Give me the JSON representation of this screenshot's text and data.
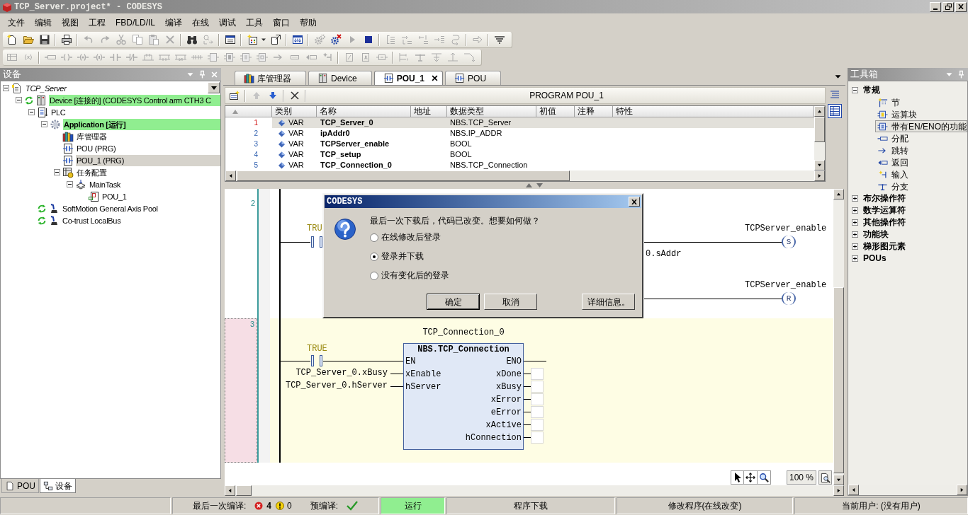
{
  "window": {
    "title": "TCP_Server.project* - CODESYS"
  },
  "menu": [
    "文件",
    "编辑",
    "视图",
    "工程",
    "FBD/LD/IL",
    "编译",
    "在线",
    "调试",
    "工具",
    "窗口",
    "帮助"
  ],
  "toolbar_1": [
    [
      {
        "kind": "new",
        "disabled": false
      },
      {
        "kind": "open",
        "disabled": false
      },
      {
        "kind": "save",
        "disabled": false
      }
    ],
    [
      {
        "kind": "print",
        "disabled": false
      }
    ],
    [
      {
        "kind": "undo",
        "disabled": true
      },
      {
        "kind": "redo",
        "disabled": true
      },
      {
        "kind": "cut",
        "disabled": true
      },
      {
        "kind": "copy",
        "disabled": true
      },
      {
        "kind": "paste",
        "disabled": true
      },
      {
        "kind": "delete",
        "disabled": true
      }
    ],
    [
      {
        "kind": "find",
        "disabled": false
      },
      {
        "kind": "replace",
        "disabled": true
      }
    ],
    [
      {
        "kind": "windows",
        "disabled": false
      }
    ],
    [
      {
        "kind": "additem",
        "disabled": false
      },
      {
        "kind": "caret",
        "disabled": false
      },
      {
        "kind": "export",
        "disabled": false
      }
    ],
    [
      {
        "kind": "build",
        "disabled": false
      }
    ],
    [
      {
        "kind": "gear",
        "disabled": true
      },
      {
        "kind": "gearstop",
        "disabled": false
      },
      {
        "kind": "play",
        "disabled": true
      },
      {
        "kind": "stop",
        "disabled": false
      }
    ],
    [
      {
        "kind": "stepover",
        "disabled": true
      },
      {
        "kind": "stepin",
        "disabled": true
      },
      {
        "kind": "stepout",
        "disabled": true
      },
      {
        "kind": "steplines",
        "disabled": true
      },
      {
        "kind": "stepback",
        "disabled": true
      }
    ],
    [
      {
        "kind": "arrow",
        "disabled": true
      }
    ],
    [
      {
        "kind": "list",
        "disabled": false
      }
    ]
  ],
  "toolbar_2": [
    [
      {
        "kind": "network",
        "disabled": true
      },
      {
        "kind": "comment",
        "disabled": true
      }
    ],
    [
      {
        "kind": "assign",
        "disabled": true
      },
      {
        "kind": "coil",
        "disabled": true
      },
      {
        "kind": "setcoil",
        "disabled": true
      },
      {
        "kind": "resetcoil",
        "disabled": true
      },
      {
        "kind": "contact",
        "disabled": true
      },
      {
        "kind": "negcontact",
        "disabled": true
      },
      {
        "kind": "branchup",
        "disabled": true
      },
      {
        "kind": "parallel",
        "disabled": true
      },
      {
        "kind": "negparallel",
        "disabled": true
      },
      {
        "kind": "multicontact",
        "disabled": true
      },
      {
        "kind": "block",
        "disabled": true
      },
      {
        "kind": "blockq",
        "disabled": true
      },
      {
        "kind": "blocken",
        "disabled": true
      },
      {
        "kind": "blockbox",
        "disabled": true
      },
      {
        "kind": "jump",
        "disabled": true
      },
      {
        "kind": "label",
        "disabled": true
      },
      {
        "kind": "ret",
        "disabled": true
      },
      {
        "kind": "input",
        "disabled": true
      }
    ],
    [
      {
        "kind": "negate",
        "disabled": true
      },
      {
        "kind": "edge",
        "disabled": true
      },
      {
        "kind": "set",
        "disabled": true
      }
    ],
    [
      {
        "kind": "branch",
        "disabled": true
      },
      {
        "kind": "tee",
        "disabled": true
      },
      {
        "kind": "branchin",
        "disabled": true
      },
      {
        "kind": "branchout",
        "disabled": true
      },
      {
        "kind": "branchdown",
        "disabled": true
      }
    ]
  ],
  "devices": {
    "title": "设备",
    "tree": [
      {
        "label": "TCP_Server",
        "kind": "project",
        "expanded": true,
        "selected": false,
        "online": false,
        "connected": false,
        "children": [
          {
            "label": "Device [连接的] (CODESYS Control arm CTH3 C",
            "kind": "device",
            "expanded": true,
            "selected": false,
            "online": true,
            "connected": true,
            "children": [
              {
                "label": "PLC",
                "kind": "plc",
                "expanded": true,
                "selected": false,
                "online": false,
                "connected": false,
                "children": [
                  {
                    "label": "Application [运行]",
                    "kind": "application",
                    "expanded": true,
                    "selected": false,
                    "online": true,
                    "connected": false,
                    "children": [
                      {
                        "label": "库管理器",
                        "kind": "library",
                        "selected": false,
                        "online": false,
                        "connected": false
                      },
                      {
                        "label": "POU (PRG)",
                        "kind": "pou",
                        "selected": false,
                        "online": false,
                        "connected": false
                      },
                      {
                        "label": "POU_1 (PRG)",
                        "kind": "pou",
                        "selected": true,
                        "online": false,
                        "connected": false
                      },
                      {
                        "label": "任务配置",
                        "kind": "taskconfig",
                        "expanded": true,
                        "selected": false,
                        "online": false,
                        "connected": false,
                        "children": [
                          {
                            "label": "MainTask",
                            "kind": "task",
                            "expanded": true,
                            "selected": false,
                            "online": false,
                            "connected": false,
                            "children": [
                              {
                                "label": "POU_1",
                                "kind": "poucall",
                                "selected": false,
                                "online": false,
                                "connected": false
                              }
                            ]
                          }
                        ]
                      }
                    ]
                  }
                ]
              },
              {
                "label": "SoftMotion General Axis Pool",
                "kind": "axis",
                "selected": false,
                "online": false,
                "connected": true
              },
              {
                "label": "Co-trust LocalBus",
                "kind": "axis",
                "selected": false,
                "online": false,
                "connected": true
              }
            ]
          }
        ]
      }
    ],
    "tabs": [
      {
        "label": "POU",
        "kind": "page",
        "selected": false
      },
      {
        "label": "设备",
        "kind": "devicetree",
        "selected": true
      }
    ]
  },
  "editor": {
    "tabs": [
      {
        "label": "库管理器",
        "kind": "library",
        "selected": false
      },
      {
        "label": "Device",
        "kind": "device",
        "selected": false
      },
      {
        "label": "POU_1",
        "kind": "pou",
        "selected": true
      },
      {
        "label": "POU",
        "kind": "pou",
        "selected": false
      }
    ],
    "tools": [
      [
        {
          "kind": "addvar",
          "disabled": false
        }
      ],
      [
        {
          "kind": "up",
          "disabled": true
        },
        {
          "kind": "down",
          "disabled": false
        }
      ],
      [
        {
          "kind": "remove",
          "disabled": false
        }
      ]
    ],
    "title": "PROGRAM POU_1",
    "columns": [
      "类别",
      "名称",
      "地址",
      "数据类型",
      "初值",
      "注释",
      "特性"
    ],
    "rows": [
      {
        "number": "1",
        "class": "VAR",
        "name": "TCP_Server_0",
        "data_type": "NBS.TCP_Server",
        "selected": true
      },
      {
        "number": "2",
        "class": "VAR",
        "name": "ipAddr0",
        "data_type": "NBS.IP_ADDR",
        "selected": false
      },
      {
        "number": "3",
        "class": "VAR",
        "name": "TCPServer_enable",
        "data_type": "BOOL",
        "selected": false
      },
      {
        "number": "4",
        "class": "VAR",
        "name": "TCP_setup",
        "data_type": "BOOL",
        "selected": false
      },
      {
        "number": "5",
        "class": "VAR",
        "name": "TCP_Connection_0",
        "data_type": "NBS.TCP_Connection",
        "selected": false
      }
    ],
    "views": [
      {
        "kind": "textview",
        "selected": false
      },
      {
        "kind": "tableview",
        "selected": true
      }
    ],
    "networks": [
      {
        "number": "2",
        "kind": "coils",
        "selected": false,
        "rungs": [
          {
            "contact": {
              "label": "TRU"
            },
            "coil": {
              "letter": "S",
              "label": "TCPServer_enable"
            },
            "note": "0.sAddr"
          },
          {
            "coil": {
              "letter": "R",
              "label": "TCPServer_enable"
            }
          }
        ]
      },
      {
        "number": "3",
        "kind": "block",
        "selected": true,
        "contact": {
          "label": "TRUE"
        },
        "block": {
          "instance": "TCP_Connection_0",
          "type": "NBS.TCP_Connection",
          "inputs": [
            {
              "pin": "EN",
              "kind": "enable"
            },
            {
              "pin": "xEnable",
              "kind": "variable",
              "value": "TCP_Server_0.xBusy"
            },
            {
              "pin": "hServer",
              "kind": "variable",
              "value": "TCP_Server_0.hServer"
            }
          ],
          "outputs": [
            {
              "pin": "ENO",
              "kind": "enable"
            },
            {
              "pin": "xDone",
              "kind": "variable"
            },
            {
              "pin": "xBusy",
              "kind": "variable"
            },
            {
              "pin": "xError",
              "kind": "variable"
            },
            {
              "pin": "eError",
              "kind": "variable"
            },
            {
              "pin": "xActive",
              "kind": "variable"
            },
            {
              "pin": "hConnection",
              "kind": "variable"
            }
          ]
        }
      }
    ],
    "zoom": "100 %"
  },
  "dialog": {
    "title": "CODESYS",
    "message": "最后一次下载后，代码已改变。想要如何做？",
    "options": [
      {
        "label": "在线修改后登录",
        "selected": false
      },
      {
        "label": "登录并下载",
        "selected": true
      },
      {
        "label": "没有变化后的登录",
        "selected": false
      }
    ],
    "buttons": [
      {
        "label": "确定",
        "default": true
      },
      {
        "label": "取消",
        "default": false
      }
    ],
    "extra_button": {
      "label": "详细信息。",
      "default": false
    }
  },
  "toolbox": {
    "title": "工具箱",
    "groups": [
      {
        "label": "常规",
        "expanded": true,
        "items": [
          {
            "label": "节",
            "kind": "section",
            "selected": false
          },
          {
            "label": "运算块",
            "kind": "blockq",
            "selected": false
          },
          {
            "label": "带有EN/ENO的功能",
            "kind": "blocken",
            "selected": true
          },
          {
            "label": "分配",
            "kind": "assign",
            "selected": false
          },
          {
            "label": "跳转",
            "kind": "jump",
            "selected": false
          },
          {
            "label": "返回",
            "kind": "ret",
            "selected": false
          },
          {
            "label": "输入",
            "kind": "input",
            "selected": false
          },
          {
            "label": "分支",
            "kind": "tee",
            "selected": false
          }
        ]
      },
      {
        "label": "布尔操作符",
        "expanded": false
      },
      {
        "label": "数学运算符",
        "expanded": false
      },
      {
        "label": "其他操作符",
        "expanded": false
      },
      {
        "label": "功能块",
        "expanded": false
      },
      {
        "label": "梯形图元素",
        "expanded": false
      },
      {
        "label": "POUs",
        "expanded": false
      }
    ]
  },
  "status_bar": {
    "last_build_label": "最后一次编译:",
    "errors": "4",
    "warnings": "0",
    "precompile_label": "预编译:",
    "precompile_ok": true,
    "run_state": "运行",
    "download": "程序下载",
    "change": "修改程序(在线改变)",
    "user": "当前用户: (没有用户)"
  }
}
